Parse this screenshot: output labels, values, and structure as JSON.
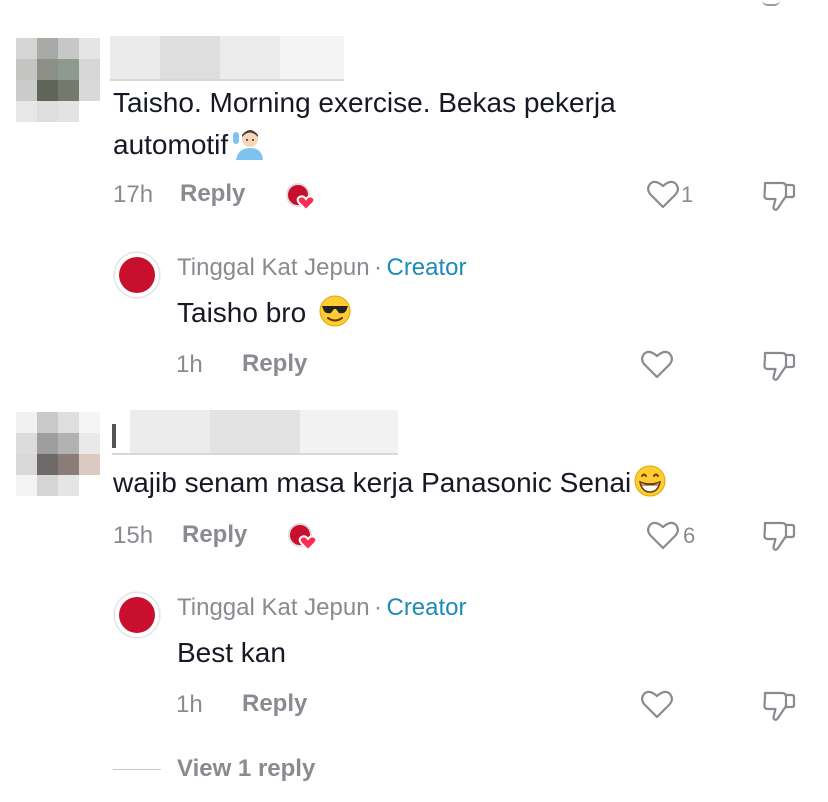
{
  "comments": [
    {
      "text_line1": "Taisho. Morning exercise. Bekas pekerja",
      "text_line2": "automotif",
      "emoji_icon": "man-raising-hand-icon",
      "time": "17h",
      "reply_label": "Reply",
      "likes": "1",
      "creator_reply": {
        "author": "Tinggal Kat Jepun",
        "separator": "·",
        "badge": "Creator",
        "text": "Taisho bro",
        "emoji_icon": "sunglasses-face-icon",
        "time": "1h",
        "reply_label": "Reply"
      }
    },
    {
      "text_line1": "wajib senam masa kerja Panasonic Senai",
      "emoji_icon": "grinning-face-icon",
      "time": "15h",
      "reply_label": "Reply",
      "likes": "6",
      "creator_reply": {
        "author": "Tinggal Kat Jepun",
        "separator": "·",
        "badge": "Creator",
        "text": "Best kan",
        "time": "1h",
        "reply_label": "Reply"
      }
    }
  ],
  "view_replies": "View 1 reply",
  "colors": {
    "text": "#161823",
    "muted": "#8a8b91",
    "creator_badge": "#1d8bb7",
    "liked_badge_red": "#c8102e",
    "liked_badge_heart": "#fe2c55"
  }
}
